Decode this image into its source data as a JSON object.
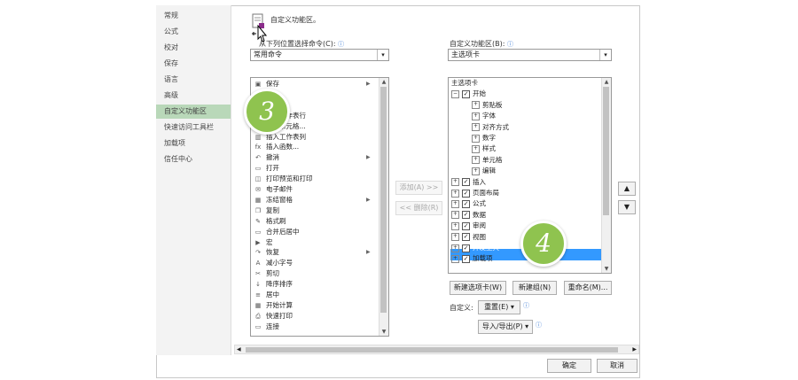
{
  "sidebar": {
    "items": [
      {
        "label": "常规"
      },
      {
        "label": "公式"
      },
      {
        "label": "校对"
      },
      {
        "label": "保存"
      },
      {
        "label": "语言"
      },
      {
        "label": "高级"
      },
      {
        "label": "自定义功能区"
      },
      {
        "label": "快速访问工具栏"
      },
      {
        "label": "加载项"
      },
      {
        "label": "信任中心"
      }
    ]
  },
  "header": {
    "title": "自定义功能区。"
  },
  "left": {
    "choose_label": "从下列位置选择命令(C):",
    "choose_value": "常用命令",
    "commands": [
      {
        "label": "保存",
        "icon": "save-icon",
        "glyph": "▣"
      },
      {
        "label": "",
        "icon": "blank-icon",
        "glyph": ""
      },
      {
        "label": "",
        "icon": "blank-icon",
        "glyph": ""
      },
      {
        "label": "插入工作表行",
        "icon": "insert-row-icon",
        "glyph": "▤"
      },
      {
        "label": "插入单元格...",
        "icon": "insert-cell-icon",
        "glyph": "▦"
      },
      {
        "label": "插入工作表列",
        "icon": "insert-col-icon",
        "glyph": "▥"
      },
      {
        "label": "插入函数...",
        "icon": "function-icon",
        "glyph": "fx"
      },
      {
        "label": "撤消",
        "icon": "undo-icon",
        "glyph": "↶"
      },
      {
        "label": "打开",
        "icon": "open-icon",
        "glyph": "▭"
      },
      {
        "label": "打印预览和打印",
        "icon": "print-preview-icon",
        "glyph": "◫"
      },
      {
        "label": "电子邮件",
        "icon": "email-icon",
        "glyph": "✉"
      },
      {
        "label": "冻结窗格",
        "icon": "freeze-icon",
        "glyph": "▦"
      },
      {
        "label": "复制",
        "icon": "copy-icon",
        "glyph": "❐"
      },
      {
        "label": "格式刷",
        "icon": "format-painter-icon",
        "glyph": "✎"
      },
      {
        "label": "合并后居中",
        "icon": "merge-icon",
        "glyph": "▭"
      },
      {
        "label": "宏",
        "icon": "macro-icon",
        "glyph": "▶"
      },
      {
        "label": "恢复",
        "icon": "redo-icon",
        "glyph": "↷"
      },
      {
        "label": "减小字号",
        "icon": "decrease-font-icon",
        "glyph": "A"
      },
      {
        "label": "剪切",
        "icon": "cut-icon",
        "glyph": "✂"
      },
      {
        "label": "降序排序",
        "icon": "sort-desc-icon",
        "glyph": "↓"
      },
      {
        "label": "居中",
        "icon": "center-icon",
        "glyph": "≡"
      },
      {
        "label": "开始计算",
        "icon": "calc-icon",
        "glyph": "▦"
      },
      {
        "label": "快速打印",
        "icon": "quick-print-icon",
        "glyph": "⎙"
      },
      {
        "label": "连接",
        "icon": "connection-icon",
        "glyph": "▭"
      }
    ],
    "submenu_rows": [
      0,
      7,
      11,
      16
    ]
  },
  "middle": {
    "add_label": "添加(A) >>",
    "remove_label": "<< 删除(R)"
  },
  "right": {
    "customize_label": "自定义功能区(B):",
    "customize_value": "主选项卡",
    "tree": [
      {
        "label": "主选项卡",
        "level": 0,
        "pm": "",
        "cb": false
      },
      {
        "label": "开始",
        "level": 0,
        "pm": "−",
        "cb": true
      },
      {
        "label": "剪贴板",
        "level": 1,
        "pm": "+",
        "cb": false
      },
      {
        "label": "字体",
        "level": 1,
        "pm": "+",
        "cb": false
      },
      {
        "label": "对齐方式",
        "level": 1,
        "pm": "+",
        "cb": false
      },
      {
        "label": "数字",
        "level": 1,
        "pm": "+",
        "cb": false
      },
      {
        "label": "样式",
        "level": 1,
        "pm": "+",
        "cb": false
      },
      {
        "label": "单元格",
        "level": 1,
        "pm": "+",
        "cb": false
      },
      {
        "label": "编辑",
        "level": 1,
        "pm": "+",
        "cb": false
      },
      {
        "label": "插入",
        "level": 0,
        "pm": "+",
        "cb": true
      },
      {
        "label": "页面布局",
        "level": 0,
        "pm": "+",
        "cb": true
      },
      {
        "label": "公式",
        "level": 0,
        "pm": "+",
        "cb": true
      },
      {
        "label": "数据",
        "level": 0,
        "pm": "+",
        "cb": true
      },
      {
        "label": "审阅",
        "level": 0,
        "pm": "+",
        "cb": true
      },
      {
        "label": "视图",
        "level": 0,
        "pm": "+",
        "cb": true
      },
      {
        "label": "开发工具",
        "level": 0,
        "pm": "+",
        "cb": true
      },
      {
        "label": "加载项",
        "level": 0,
        "pm": "+",
        "cb": true
      }
    ],
    "new_tab_label": "新建选项卡(W)",
    "new_group_label": "新建组(N)",
    "rename_label": "重命名(M)...",
    "customize_text": "自定义:",
    "reset_label": "重置(E) ▾",
    "import_export_label": "导入/导出(P) ▾"
  },
  "footer": {
    "ok_label": "确定",
    "cancel_label": "取消"
  },
  "bubbles": {
    "step3": "3",
    "step4": "4"
  },
  "colors": {
    "bubble": "#8fc34f",
    "selection": "#3399ff",
    "sidebar_active": "#b9d8b9"
  }
}
